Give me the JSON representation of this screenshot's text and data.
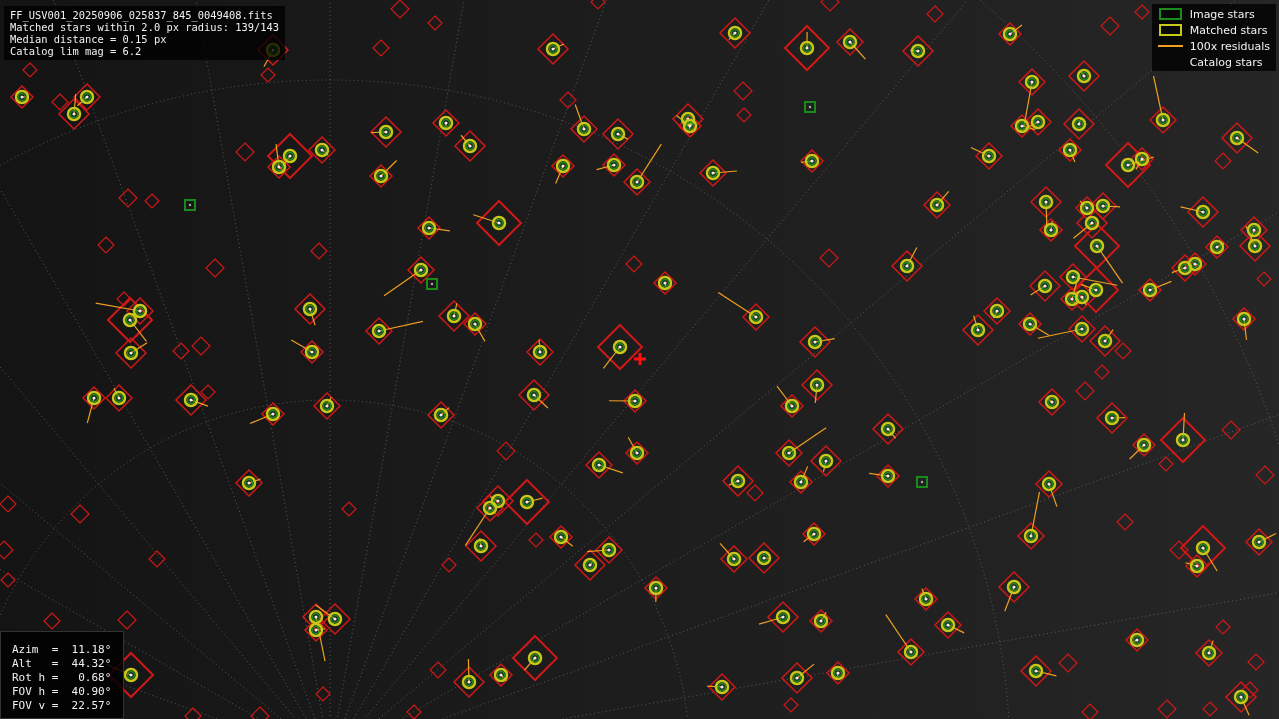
{
  "info": {
    "lines": [
      "FF_USV001_20250906_025837_845_0049408.fits",
      "Matched stars within 2.0 px radius: 139/143",
      "Median distance = 0.15 px",
      "Catalog lim mag = 6.2"
    ]
  },
  "legend": [
    {
      "label": "Image stars",
      "kind": "image"
    },
    {
      "label": "Matched stars",
      "kind": "matched"
    },
    {
      "label": "100x residuals",
      "kind": "residual"
    },
    {
      "label": "Catalog stars",
      "kind": "catalog"
    }
  ],
  "pointing": [
    "Azim  =  11.18°",
    "Alt   =  44.32°",
    "Rot h =   0.68°",
    "FOV h =  40.90°",
    "FOV v =  22.57°"
  ]
}
